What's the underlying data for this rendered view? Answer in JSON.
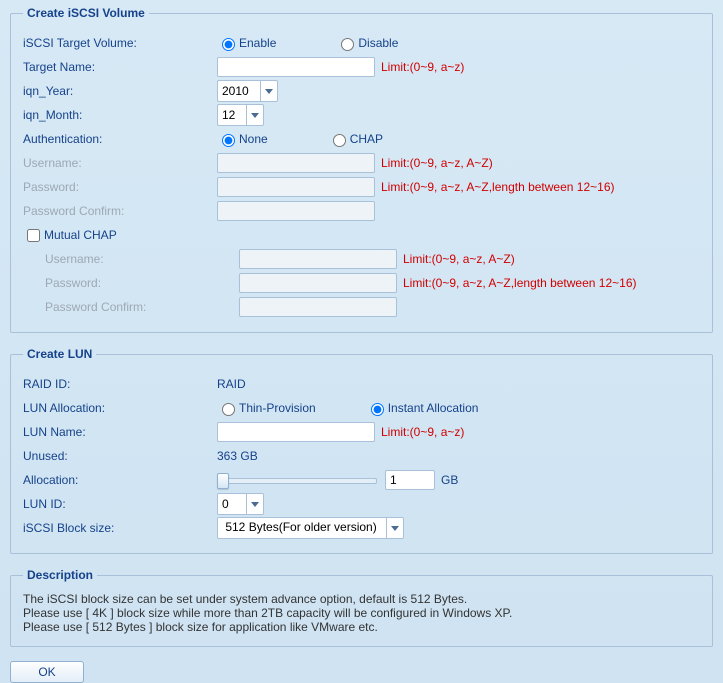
{
  "volume": {
    "legend": "Create iSCSI Volume",
    "target_volume_label": "iSCSI Target Volume:",
    "enable": "Enable",
    "disable": "Disable",
    "target_name_label": "Target Name:",
    "target_name_value": "",
    "target_name_limit": "Limit:(0~9, a~z)",
    "year_label": "iqn_Year:",
    "year_value": "2010",
    "month_label": "iqn_Month:",
    "month_value": "12",
    "auth_label": "Authentication:",
    "auth_none": "None",
    "auth_chap": "CHAP",
    "username_label": "Username:",
    "username_limit": "Limit:(0~9, a~z, A~Z)",
    "password_label": "Password:",
    "password_limit": "Limit:(0~9, a~z, A~Z,length between 12~16)",
    "password_confirm_label": "Password Confirm:",
    "mutual_chap": "Mutual CHAP"
  },
  "lun": {
    "legend": "Create LUN",
    "raid_id_label": "RAID ID:",
    "raid_id_value": "RAID",
    "alloc_label": "LUN Allocation:",
    "thin": "Thin-Provision",
    "instant": "Instant Allocation",
    "name_label": "LUN Name:",
    "name_value": "",
    "name_limit": "Limit:(0~9, a~z)",
    "unused_label": "Unused:",
    "unused_value": "363 GB",
    "allocation_label": "Allocation:",
    "allocation_value": "1",
    "allocation_unit": "GB",
    "lun_id_label": "LUN ID:",
    "lun_id_value": "0",
    "block_label": "iSCSI Block size:",
    "block_value": " 512 Bytes(For older version) "
  },
  "desc": {
    "legend": "Description",
    "l1": "The iSCSI block size can be set under system advance option, default is 512 Bytes.",
    "l2": "Please use [ 4K ] block size while more than 2TB capacity will be configured in Windows XP.",
    "l3": "Please use [ 512 Bytes ] block size for application like VMware etc."
  },
  "ok": "OK"
}
